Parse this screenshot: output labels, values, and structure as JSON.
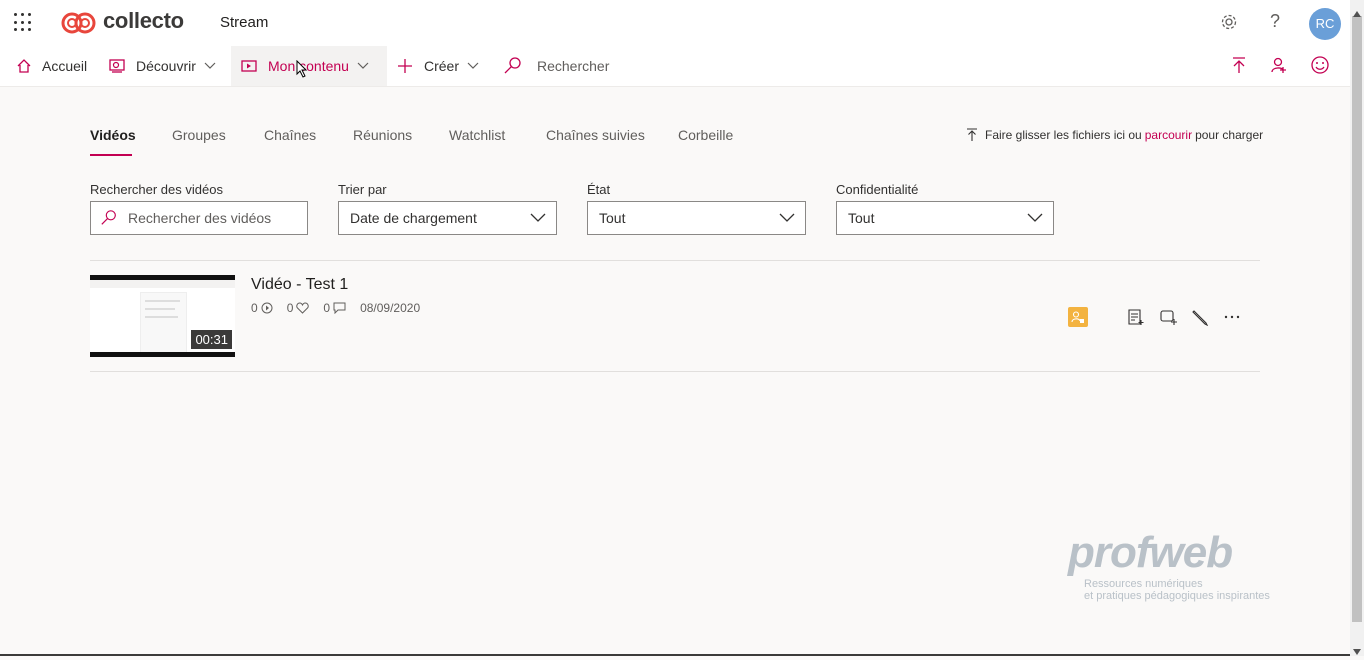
{
  "header": {
    "brand": "collecto",
    "app": "Stream",
    "avatar_initials": "RC",
    "help_label": "?"
  },
  "nav": {
    "home": "Accueil",
    "discover": "Découvrir",
    "my_content": "Mon contenu",
    "create": "Créer",
    "search": "Rechercher"
  },
  "tabs": [
    "Vidéos",
    "Groupes",
    "Chaînes",
    "Réunions",
    "Watchlist",
    "Chaînes suivies",
    "Corbeille"
  ],
  "upload_hint": {
    "before": "Faire glisser les fichiers ici ou",
    "link": "parcourir",
    "after": "pour charger"
  },
  "filters": {
    "search_label": "Rechercher des vidéos",
    "search_placeholder": "Rechercher des vidéos",
    "sort_label": "Trier par",
    "sort_value": "Date de chargement",
    "state_label": "État",
    "state_value": "Tout",
    "privacy_label": "Confidentialité",
    "privacy_value": "Tout"
  },
  "videos": [
    {
      "title": "Vidéo - Test 1",
      "duration": "00:31",
      "views": "0",
      "likes": "0",
      "comments": "0",
      "date": "08/09/2020"
    }
  ],
  "watermark": {
    "logo": "profweb",
    "line1": "Ressources numériques",
    "line2": "et pratiques pédagogiques inspirantes"
  },
  "colors": {
    "accent": "#c30052",
    "avatar": "#6a9fd8",
    "badge": "#f3b340"
  }
}
